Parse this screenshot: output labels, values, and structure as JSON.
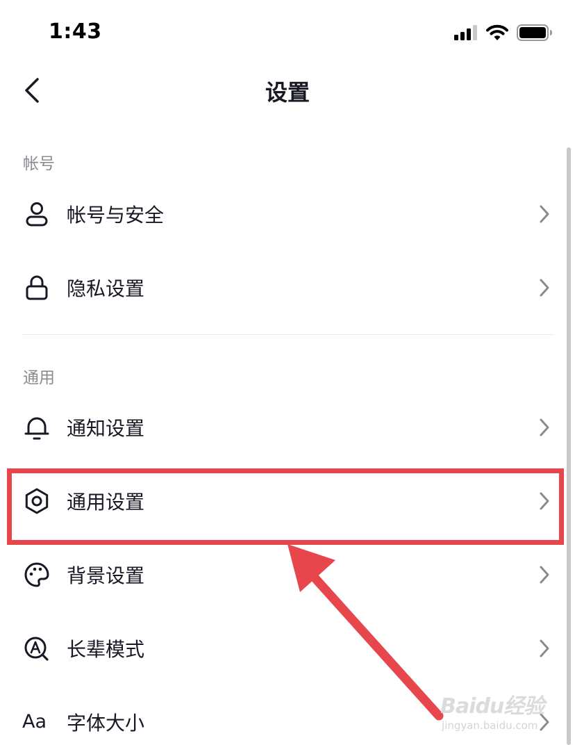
{
  "status_bar": {
    "time": "1:43",
    "icons": [
      "signal-icon",
      "wifi-icon",
      "battery-icon"
    ]
  },
  "nav": {
    "title": "设置",
    "back_icon": "chevron-left-icon"
  },
  "sections": [
    {
      "header": "帐号",
      "items": [
        {
          "label": "帐号与安全",
          "icon": "user-icon"
        },
        {
          "label": "隐私设置",
          "icon": "lock-icon"
        }
      ]
    },
    {
      "header": "通用",
      "items": [
        {
          "label": "通知设置",
          "icon": "bell-icon"
        },
        {
          "label": "通用设置",
          "icon": "gear-icon",
          "highlighted": true
        },
        {
          "label": "背景设置",
          "icon": "palette-icon"
        },
        {
          "label": "长辈模式",
          "icon": "elder-mode-icon"
        },
        {
          "label": "字体大小",
          "icon": "font-size-icon",
          "icon_text": "Aa"
        }
      ]
    }
  ],
  "colors": {
    "text": "#161823",
    "secondary_text": "#8a8b91",
    "annotation": "#e8464d",
    "divider": "#e8e8ea"
  },
  "watermark": {
    "brand": "Baidu经验",
    "url": "jingyan.baidu.com"
  }
}
